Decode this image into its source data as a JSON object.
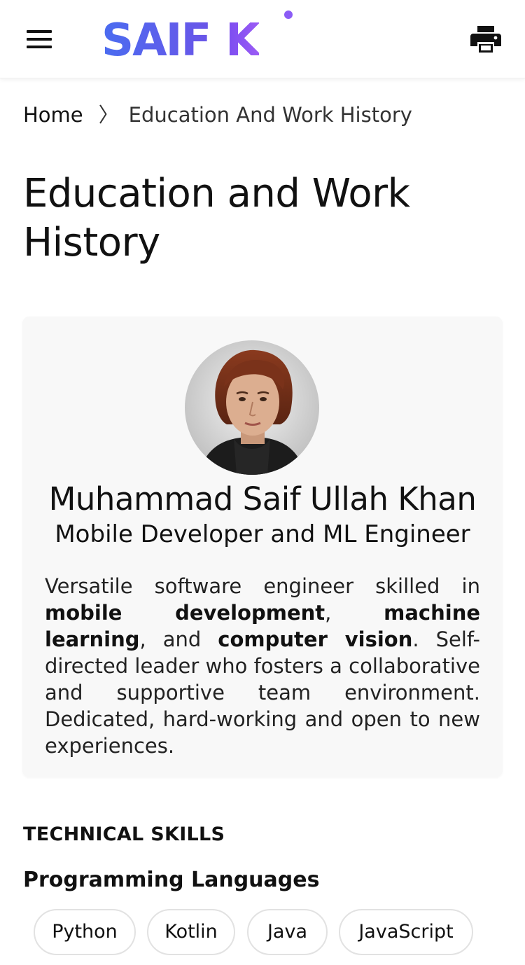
{
  "header": {
    "logo_first": "SAIF",
    "logo_last": "K",
    "logo_colors": [
      "#4a6cf0",
      "#8b5cf6"
    ],
    "menu_icon": "hamburger-menu-icon",
    "print_icon": "printer-icon"
  },
  "breadcrumb": {
    "home": "Home",
    "separator": "〉",
    "current": "Education And Work History"
  },
  "page": {
    "title": "Education and Work History"
  },
  "profile": {
    "avatar_alt": "profile-photo",
    "name": "Muhammad Saif Ullah Khan",
    "role": "Mobile Developer and ML Engineer",
    "bio": {
      "p1": "Versatile software engineer skilled in ",
      "b1": "mobile development",
      "p2": ", ",
      "b2": "machine learning",
      "p3": ", and ",
      "b3": "computer vision",
      "p4": ". Self-directed leader who fosters a collaborative and supportive team environment. Dedicated, hard-working and open to new experiences."
    }
  },
  "skills": {
    "section_title": "TECHNICAL SKILLS",
    "programming_title": "Programming Languages",
    "programming": [
      "Python",
      "Kotlin",
      "Java",
      "JavaScript"
    ]
  }
}
